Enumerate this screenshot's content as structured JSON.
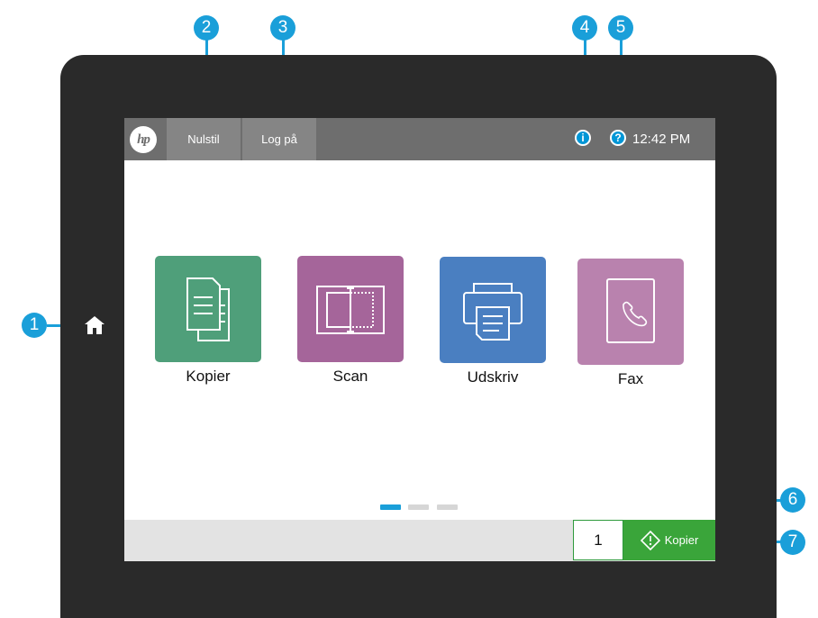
{
  "device": {
    "topbar": {
      "logo_text": "hp",
      "reset_label": "Nulstil",
      "signin_label": "Log på",
      "info_symbol": "i",
      "help_symbol": "?",
      "time": "12:42 PM"
    },
    "apps": [
      {
        "label": "Kopier",
        "color": "#4f9f7a",
        "icon": "copy-icon"
      },
      {
        "label": "Scan",
        "color": "#a5659a",
        "icon": "scan-icon"
      },
      {
        "label": "Udskriv",
        "color": "#4a7fc1",
        "icon": "printer-icon"
      },
      {
        "label": "Fax",
        "color": "#b982ae",
        "icon": "fax-icon"
      }
    ],
    "page_indicator": {
      "pages": 3,
      "active": 1,
      "active_color": "#1a9fd9",
      "inactive_color": "#d6d6d6"
    },
    "bottombar": {
      "copies": "1",
      "start_label": "Kopier",
      "start_color": "#3aa53a"
    },
    "home_icon": "home-icon"
  },
  "callouts": [
    "1",
    "2",
    "3",
    "4",
    "5",
    "6",
    "7"
  ]
}
